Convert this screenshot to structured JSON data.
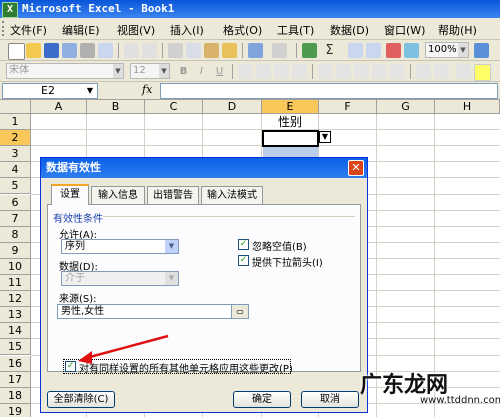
{
  "window": {
    "title": "Microsoft Excel - Book1",
    "app_icon": "X"
  },
  "menu": [
    "文件(F)",
    "编辑(E)",
    "视图(V)",
    "插入(I)",
    "格式(O)",
    "工具(T)",
    "数据(D)",
    "窗口(W)",
    "帮助(H)"
  ],
  "toolbar": {
    "zoom": "100%",
    "font_name": "宋体",
    "font_size": "12",
    "sum_symbol": "Σ"
  },
  "formula_bar": {
    "name_box": "E2",
    "fx": "fx"
  },
  "sheet": {
    "columns": [
      "A",
      "B",
      "C",
      "D",
      "E",
      "F",
      "G",
      "H"
    ],
    "rows": [
      "1",
      "2",
      "3",
      "4",
      "5",
      "6",
      "7",
      "8",
      "9",
      "10",
      "11",
      "12",
      "13",
      "14",
      "15",
      "16",
      "17",
      "18",
      "19"
    ],
    "selected_column": "E",
    "selected_row": "2",
    "e1_value": "性别"
  },
  "dialog": {
    "title": "数据有效性",
    "tabs": [
      "设置",
      "输入信息",
      "出错警告",
      "输入法模式"
    ],
    "active_tab": "设置",
    "group_title": "有效性条件",
    "allow_label": "允许(A):",
    "allow_value": "序列",
    "data_label": "数据(D):",
    "data_value": "介于",
    "ignore_blank": {
      "label": "忽略空值(B)",
      "checked": true
    },
    "dropdown_arrow": {
      "label": "提供下拉箭头(I)",
      "checked": true
    },
    "source_label": "来源(S):",
    "source_value": "男性,女性",
    "apply_all": {
      "label": "对有同样设置的所有其他单元格应用这些更改(P)",
      "checked": true
    },
    "clear_all_button": "全部清除(C)",
    "ok_button": "确定",
    "cancel_button": "取消"
  },
  "watermark": {
    "text": "广东龙网",
    "url": "www.ttddnn.com"
  }
}
